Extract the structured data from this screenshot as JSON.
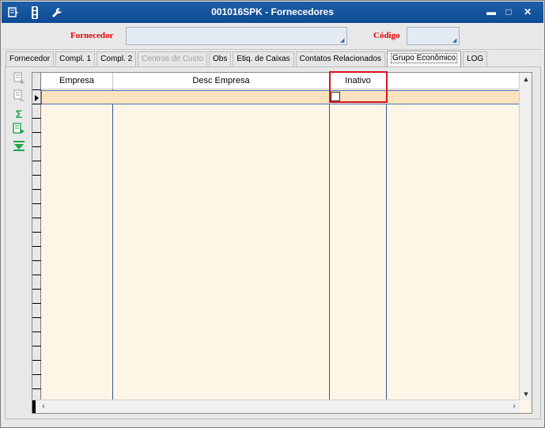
{
  "window": {
    "title": "001016SPK - Fornecedores",
    "title_icons": [
      "menu-icon",
      "traffic-light-icon",
      "wrench-icon"
    ],
    "controls": {
      "minimize": "▬",
      "maximize": "□",
      "close": "✕"
    }
  },
  "header": {
    "fornecedor_label": "Fornecedor",
    "fornecedor_value": "",
    "codigo_label": "Código",
    "codigo_value": ""
  },
  "tabs": [
    {
      "label": "Fornecedor",
      "state": "normal"
    },
    {
      "label": "Compl. 1",
      "state": "normal"
    },
    {
      "label": "Compl. 2",
      "state": "normal"
    },
    {
      "label": "Centros de Custo",
      "state": "disabled"
    },
    {
      "label": "Obs",
      "state": "normal"
    },
    {
      "label": "Etiq. de Caixas",
      "state": "normal"
    },
    {
      "label": "Contatos Relacionados",
      "state": "normal"
    },
    {
      "label": "Grupo Econômico",
      "state": "active"
    },
    {
      "label": "LOG",
      "state": "normal"
    }
  ],
  "toolbar": {
    "icons": [
      "add-record-icon",
      "remove-record-icon",
      "sum-icon",
      "export-icon",
      "filter-down-icon"
    ]
  },
  "grid": {
    "columns": [
      {
        "label": "Empresa"
      },
      {
        "label": "Desc Empresa"
      },
      {
        "label": "Inativo"
      }
    ],
    "rows": [
      {
        "empresa": "",
        "desc_empresa": "",
        "inativo": false
      }
    ]
  },
  "colors": {
    "titlebar": "#1a5aa4",
    "required_label": "#e00000",
    "grid_background": "#fdf5e6",
    "highlight_box": "#d9141e"
  }
}
